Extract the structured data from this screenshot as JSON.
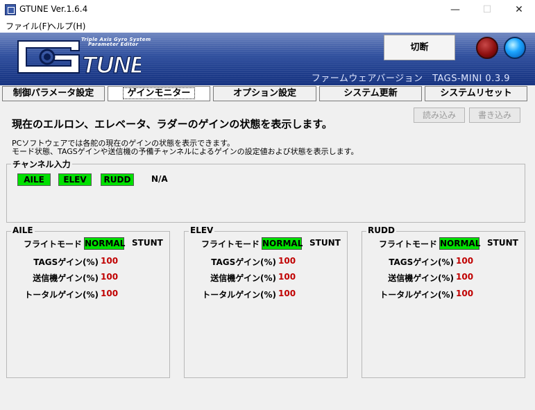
{
  "window": {
    "title": "GTUNE Ver.1.6.4",
    "controls": {
      "minimize": "—",
      "maximize": "☐",
      "close": "✕"
    }
  },
  "menu": [
    "ファイル(F)",
    "ヘルプ(H)"
  ],
  "banner": {
    "logo_text": "TUNE",
    "tagline": [
      "Triple Axis Gyro System",
      "Parameter Editor"
    ],
    "firmware_version": "ファームウェアバージョン　TAGS-MINI  0.3.9",
    "disconnect_label": "切断",
    "colors": {
      "banner": "#14317f",
      "led_red": "#8e1010",
      "led_blue": "#1ea6ff"
    }
  },
  "tabs": [
    {
      "label": "制御パラメータ設定"
    },
    {
      "label": "ゲインモニター"
    },
    {
      "label": "オプション設定"
    },
    {
      "label": "システム更新"
    },
    {
      "label": "システムリセット"
    }
  ],
  "actions": {
    "read_label": "読み込み",
    "write_label": "書き込み"
  },
  "page": {
    "heading": "現在のエルロン、エレベータ、ラダーのゲインの状態を表示します。",
    "desc1": "PCソフトウェアでは各舵の現在のゲインの状態を表示できます。",
    "desc2": "モード状態、TAGSゲインや送信機の予備チャンネルによるゲインの設定値および状態を表示します。"
  },
  "channel_input": {
    "title": "チャンネル入力",
    "badges": [
      "AILE",
      "ELEV",
      "RUDD"
    ],
    "status": "N/A",
    "badge_color": "#00e000"
  },
  "panels": [
    {
      "title": "AILE",
      "flight_mode_label": "フライトモード",
      "mode_normal": "NORMAL",
      "mode_stunt": "STUNT",
      "tags_gain_label": "TAGSゲイン(%)",
      "tags_gain": "100",
      "tx_gain_label": "送信機ゲイン(%)",
      "tx_gain": "100",
      "total_gain_label": "トータルゲイン(%)",
      "total_gain": "100"
    },
    {
      "title": "ELEV",
      "flight_mode_label": "フライトモード",
      "mode_normal": "NORMAL",
      "mode_stunt": "STUNT",
      "tags_gain_label": "TAGSゲイン(%)",
      "tags_gain": "100",
      "tx_gain_label": "送信機ゲイン(%)",
      "tx_gain": "100",
      "total_gain_label": "トータルゲイン(%)",
      "total_gain": "100"
    },
    {
      "title": "RUDD",
      "flight_mode_label": "フライトモード",
      "mode_normal": "NORMAL",
      "mode_stunt": "STUNT",
      "tags_gain_label": "TAGSゲイン(%)",
      "tags_gain": "100",
      "tx_gain_label": "送信機ゲイン(%)",
      "tx_gain": "100",
      "total_gain_label": "トータルゲイン(%)",
      "total_gain": "100"
    }
  ]
}
